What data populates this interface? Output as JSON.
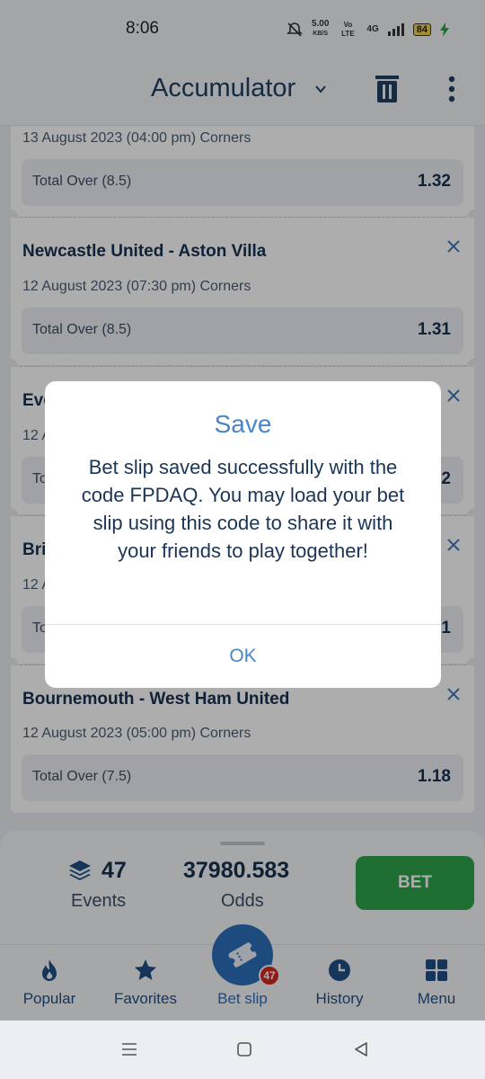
{
  "status_bar": {
    "time": "8:06",
    "speed": "5.00",
    "speed_unit": "KB/S",
    "volte": "Vo LTE",
    "network": "4G",
    "battery": "84"
  },
  "app_bar": {
    "title": "Accumulator"
  },
  "bets": [
    {
      "teams": "",
      "date": "13 August 2023 (04:00 pm) Corners",
      "market": "Total Over (8.5)",
      "odds": "1.32"
    },
    {
      "teams": "Newcastle United - Aston Villa",
      "date": "12 August 2023 (07:30 pm) Corners",
      "market": "Total Over (8.5)",
      "odds": "1.31"
    },
    {
      "teams": "Eve",
      "date": "12 A",
      "market": "To",
      "odds": "2"
    },
    {
      "teams": "Bri",
      "date": "12 A",
      "market": "To",
      "odds": "1"
    },
    {
      "teams": "Bournemouth - West Ham United",
      "date": "12 August 2023 (05:00 pm) Corners",
      "market": "Total Over (7.5)",
      "odds": "1.18"
    }
  ],
  "summary": {
    "events_count": "47",
    "events_label": "Events",
    "odds_total": "37980.583",
    "odds_label": "Odds",
    "bet_label": "BET"
  },
  "nav": {
    "items": [
      {
        "label": "Popular",
        "icon": "flame-icon"
      },
      {
        "label": "Favorites",
        "icon": "star-icon"
      },
      {
        "label": "Bet slip",
        "icon": "ticket-icon"
      },
      {
        "label": "History",
        "icon": "clock-icon"
      },
      {
        "label": "Menu",
        "icon": "grid-icon"
      }
    ],
    "badge": "47"
  },
  "dialog": {
    "title": "Save",
    "message": "Bet slip saved successfully with the code FPDAQ. You may load your bet slip using this code to share it with your friends to play together!",
    "ok": "OK"
  },
  "colors": {
    "accent": "#4a86c5",
    "bet_green": "#2fa44a",
    "primary_dark": "#1f3e63",
    "badge_red": "#d6281e"
  }
}
